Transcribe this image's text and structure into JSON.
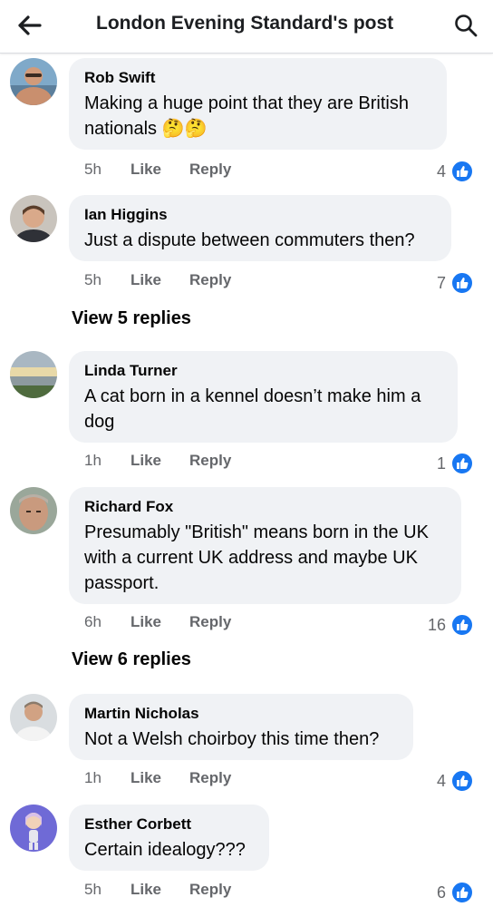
{
  "header": {
    "title": "London Evening Standard's post",
    "back_icon": "arrow-left-icon",
    "search_icon": "search-icon"
  },
  "actions": {
    "like_label": "Like",
    "reply_label": "Reply"
  },
  "comments": [
    {
      "author": "Rob Swift",
      "text": "Making a huge point that they are British nationals 🤔🤔",
      "time": "5h",
      "likes": "4"
    },
    {
      "author": "Ian Higgins",
      "text": "Just a dispute between commuters then?",
      "time": "5h",
      "likes": "7",
      "view_replies": "View 5 replies"
    },
    {
      "author": "Linda Turner",
      "text": "A cat born in a kennel doesn’t make him a dog",
      "time": "1h",
      "likes": "1"
    },
    {
      "author": "Richard Fox",
      "text": "Presumably \"British\" means born in the UK with a current UK address and maybe UK passport.",
      "time": "6h",
      "likes": "16",
      "view_replies": "View 6 replies"
    },
    {
      "author": "Martin Nicholas",
      "text": "Not a Welsh choirboy this time then?",
      "time": "1h",
      "likes": "4"
    },
    {
      "author": "Esther Corbett",
      "text": "Certain idealogy???",
      "time": "5h",
      "likes": "6"
    }
  ],
  "colors": {
    "accent": "#1877f2",
    "bubble": "#f0f2f5",
    "muted_text": "#65676b"
  }
}
